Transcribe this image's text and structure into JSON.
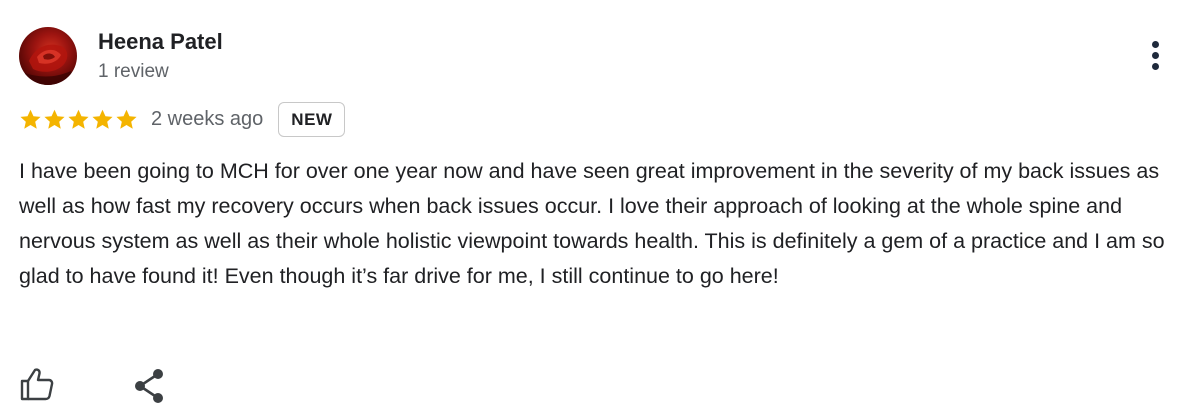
{
  "reviewer": {
    "name": "Heena Patel",
    "review_count": "1 review",
    "avatar_icon": "rose-avatar"
  },
  "menu": {
    "icon": "more-vert-icon"
  },
  "rating": {
    "stars": 5,
    "max_stars": 5,
    "star_color": "#f4b400",
    "time_ago": "2 weeks ago",
    "badge": "NEW"
  },
  "review": {
    "text": "I have been going to MCH for over one year now and have seen great improvement in the severity of my back issues as well as how fast my recovery occurs when back issues occur. I love their approach of looking at the whole spine and nervous system as well as their whole holistic viewpoint towards health. This is definitely a gem of a practice and I am so glad to have found it! Even though it’s far drive for me, I still continue to go here!"
  },
  "actions": {
    "like_icon": "thumbs-up-icon",
    "share_icon": "share-icon"
  }
}
